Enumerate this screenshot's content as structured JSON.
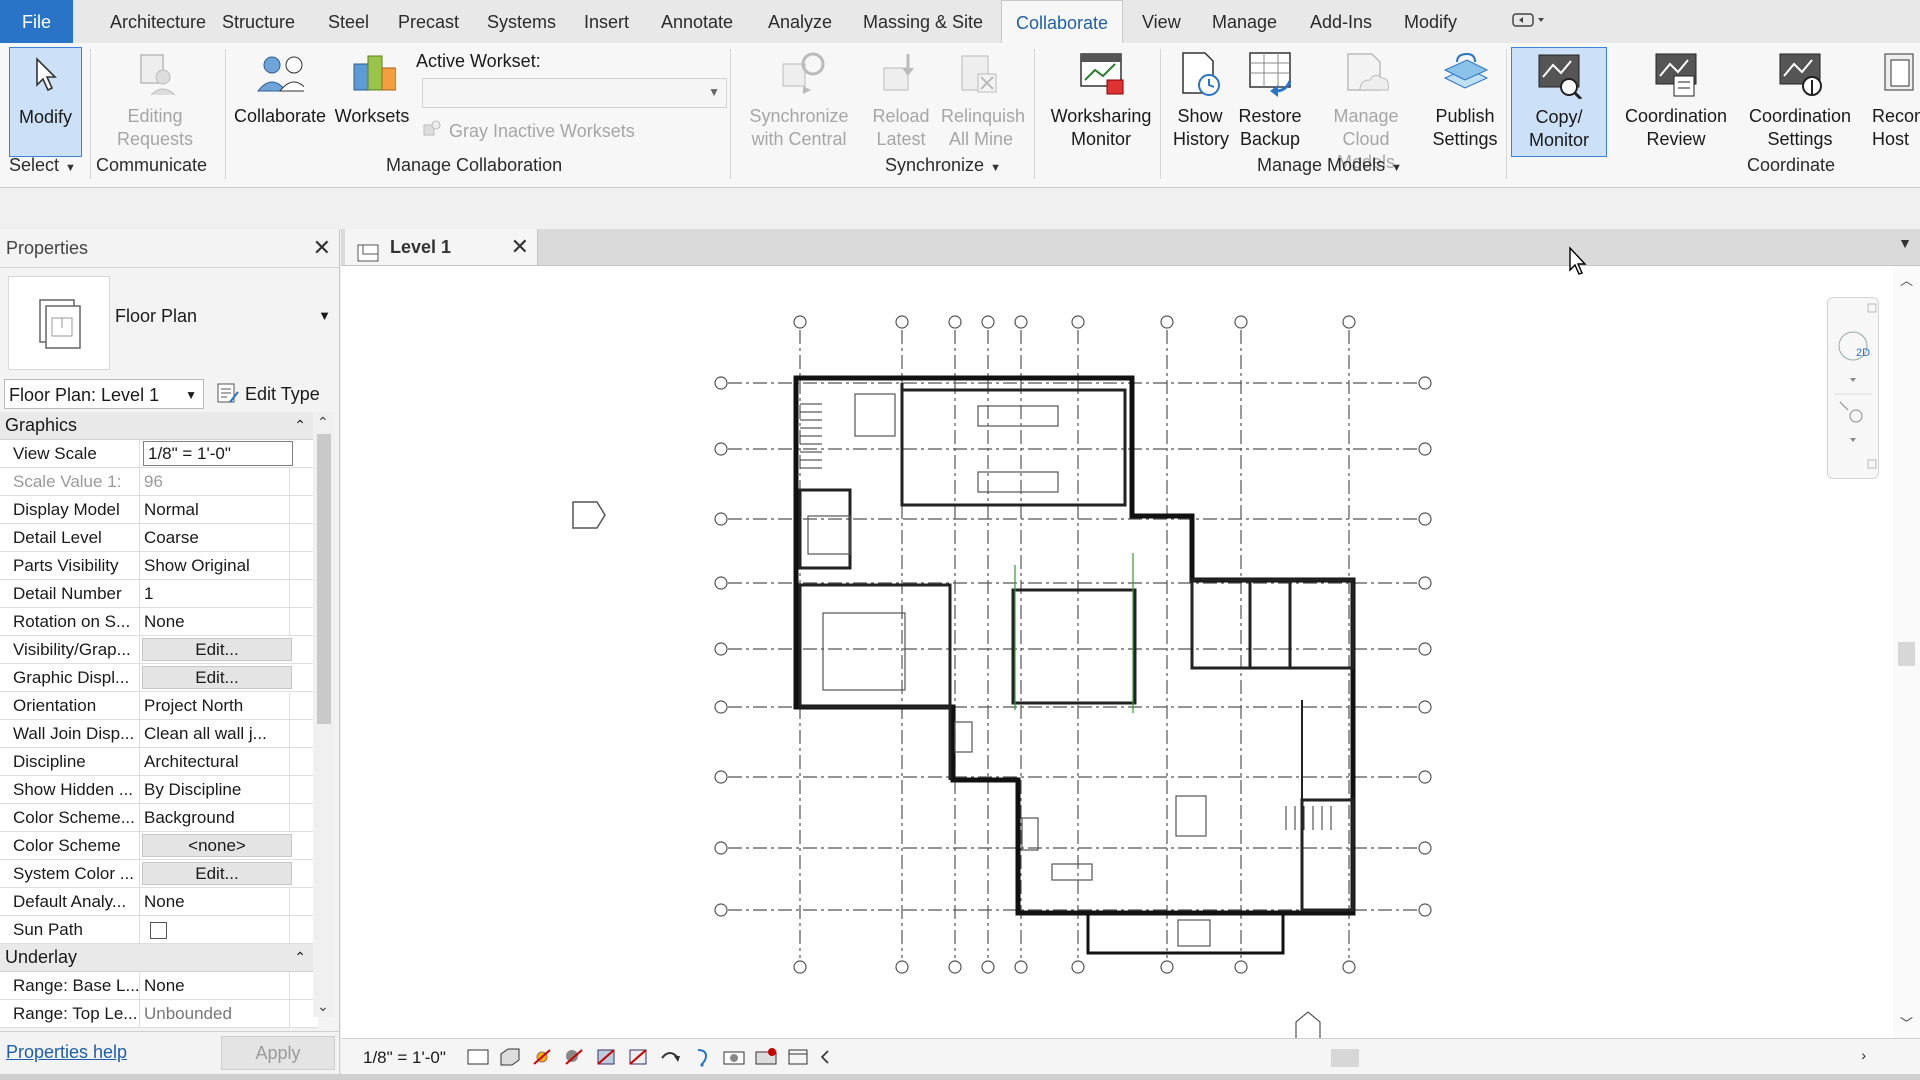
{
  "ribbon_tabs": [
    "File",
    "Architecture",
    "Structure",
    "Steel",
    "Precast",
    "Systems",
    "Insert",
    "Annotate",
    "Analyze",
    "Massing & Site",
    "Collaborate",
    "View",
    "Manage",
    "Add-Ins",
    "Modify"
  ],
  "active_tab": "Collaborate",
  "ribbon": {
    "modify": "Modify",
    "select": "Select",
    "editing_requests": "Editing Requests",
    "communicate": "Communicate",
    "collaborate": "Collaborate",
    "worksets": "Worksets",
    "active_workset_label": "Active Workset:",
    "active_workset_value": "",
    "gray_inactive": "Gray Inactive Worksets",
    "manage_collaboration": "Manage Collaboration",
    "sync_central": "Synchronize with Central",
    "reload_latest": "Reload Latest",
    "relinquish": "Relinquish All Mine",
    "synchronize": "Synchronize",
    "worksharing_monitor": "Worksharing Monitor",
    "show_history": "Show History",
    "restore_backup": "Restore Backup",
    "manage_cloud": "Manage Cloud Models",
    "manage_models": "Manage Models",
    "publish_settings": "Publish Settings",
    "copy_monitor": "Copy/ Monitor",
    "coordination_review": "Coordination Review",
    "coordination_settings": "Coordination Settings",
    "reconcile_hosting": "Recon Host",
    "coordinate": "Coordinate"
  },
  "properties": {
    "title": "Properties",
    "type_name": "Floor Plan",
    "view_selector": "Floor Plan: Level 1",
    "edit_type": "Edit Type",
    "group_graphics": "Graphics",
    "group_underlay": "Underlay",
    "rows": [
      {
        "k": "View Scale",
        "v": "1/8\" = 1'-0\""
      },
      {
        "k": "Scale Value    1:",
        "v": "96"
      },
      {
        "k": "Display Model",
        "v": "Normal"
      },
      {
        "k": "Detail Level",
        "v": "Coarse"
      },
      {
        "k": "Parts Visibility",
        "v": "Show Original"
      },
      {
        "k": "Detail Number",
        "v": "1"
      },
      {
        "k": "Rotation on S...",
        "v": "None"
      },
      {
        "k": "Visibility/Grap...",
        "v": "Edit..."
      },
      {
        "k": "Graphic Displ...",
        "v": "Edit..."
      },
      {
        "k": "Orientation",
        "v": "Project North"
      },
      {
        "k": "Wall Join Disp...",
        "v": "Clean all wall j..."
      },
      {
        "k": "Discipline",
        "v": "Architectural"
      },
      {
        "k": "Show Hidden ...",
        "v": "By Discipline"
      },
      {
        "k": "Color Scheme...",
        "v": "Background"
      },
      {
        "k": "Color Scheme",
        "v": "<none>"
      },
      {
        "k": "System Color ...",
        "v": "Edit..."
      },
      {
        "k": "Default Analy...",
        "v": "None"
      },
      {
        "k": "Sun Path",
        "v": ""
      }
    ],
    "underlay_rows": [
      {
        "k": "Range: Base L...",
        "v": "None"
      },
      {
        "k": "Range: Top Le...",
        "v": "Unbounded"
      }
    ],
    "help": "Properties help",
    "apply": "Apply"
  },
  "view_tab": "Level 1",
  "status": {
    "scale": "1/8\" = 1'-0\""
  },
  "colors": {
    "accent": "#2a74c7",
    "selected": "#cce0f7"
  }
}
